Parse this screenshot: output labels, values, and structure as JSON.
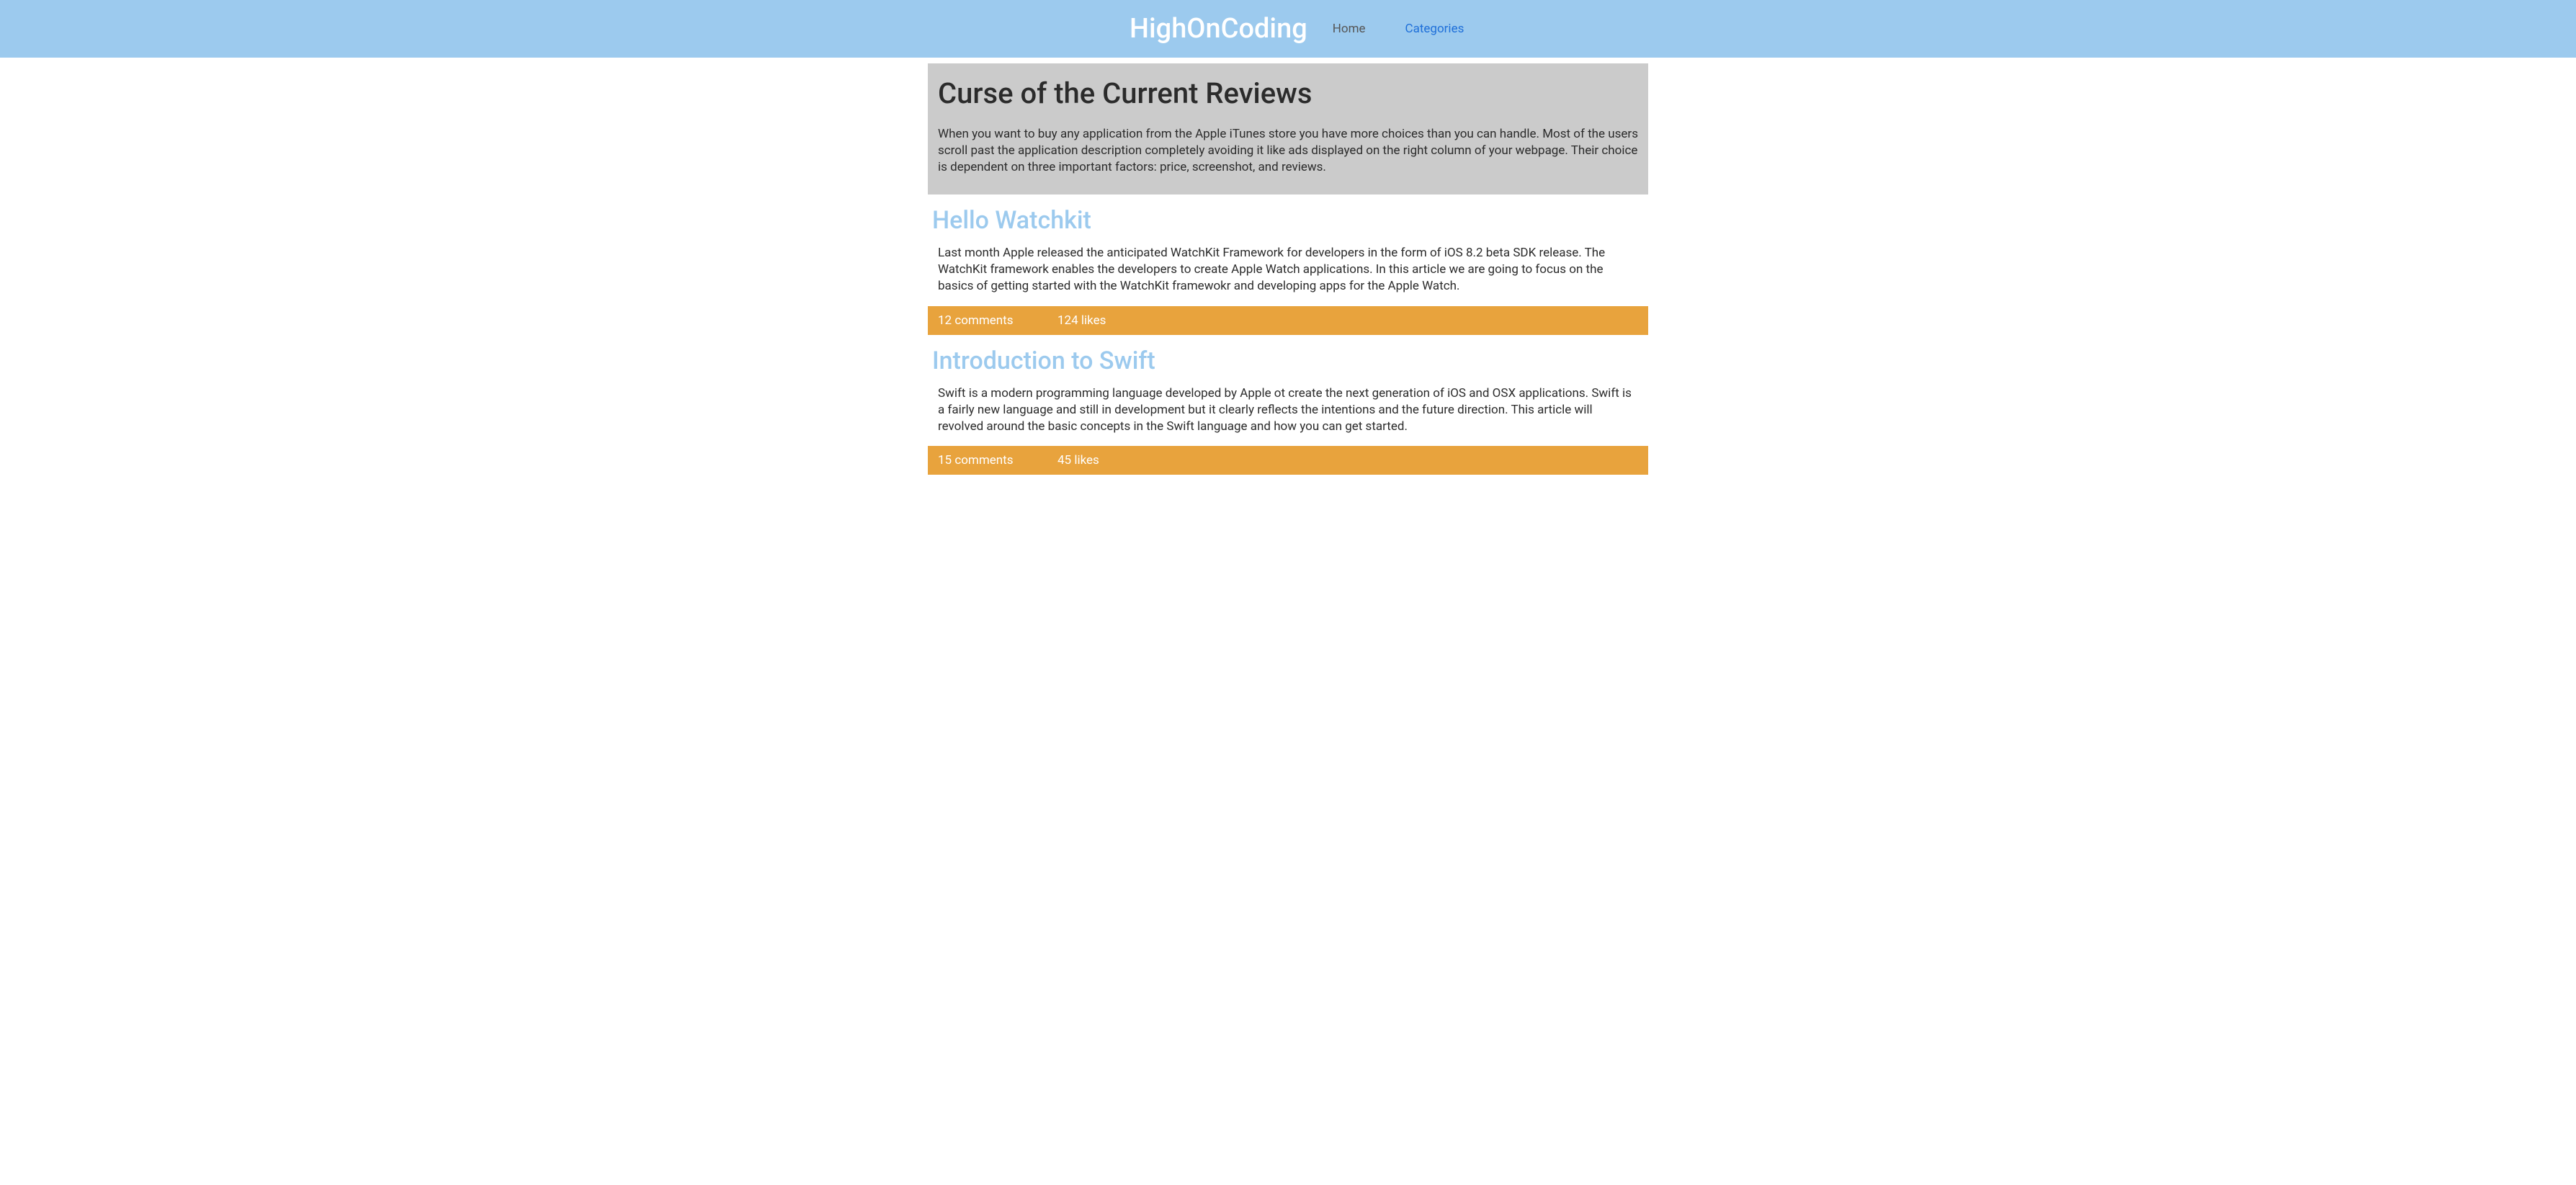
{
  "header": {
    "site_title": "HighOnCoding",
    "nav": {
      "home": "Home",
      "categories": "Categories"
    }
  },
  "hero": {
    "title": "Curse of the Current Reviews",
    "text": "When you want to buy any application from the Apple iTunes store you have more choices than you can handle. Most of the users scroll past the application description completely avoiding it like ads displayed on the right column of your webpage. Their choice is dependent on three important factors: price, screenshot, and reviews."
  },
  "articles": [
    {
      "title": "Hello Watchkit",
      "body": "Last month Apple released the anticipated WatchKit Framework for developers in the form of iOS 8.2 beta SDK release. The WatchKit framework enables the developers to create Apple Watch applications. In this article we are going to focus on the basics of getting started with the WatchKit framewokr and developing apps for the Apple Watch.",
      "comments": "12 comments",
      "likes": "124 likes"
    },
    {
      "title": "Introduction to Swift",
      "body": "Swift is a modern programming language developed by Apple ot create the next generation of iOS and OSX applications. Swift is a fairly new language and still in development but it clearly reflects the intentions and the future direction. This article will revolved around the basic concepts in the Swift language and how you can get started.",
      "comments": "15 comments",
      "likes": "45 likes"
    }
  ]
}
